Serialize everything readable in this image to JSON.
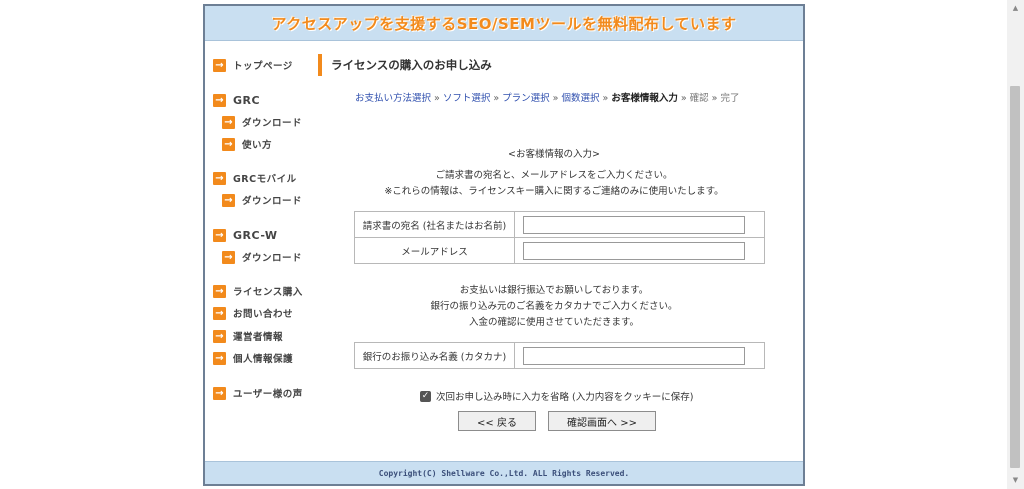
{
  "banner": {
    "text": "アクセスアップを支援するSEO/SEMツールを無料配布しています"
  },
  "sidebar": {
    "items": [
      {
        "label": "トップページ"
      },
      {
        "label": "GRC"
      },
      {
        "label": "ダウンロード"
      },
      {
        "label": "使い方"
      },
      {
        "label": "GRCモバイル"
      },
      {
        "label": "ダウンロード"
      },
      {
        "label": "GRC-W"
      },
      {
        "label": "ダウンロード"
      },
      {
        "label": "ライセンス購入"
      },
      {
        "label": "お問い合わせ"
      },
      {
        "label": "運営者情報"
      },
      {
        "label": "個人情報保護"
      },
      {
        "label": "ユーザー様の声"
      }
    ]
  },
  "main": {
    "heading": "ライセンスの購入のお申し込み",
    "breadcrumb": {
      "steps": [
        "お支払い方法選択",
        "ソフト選択",
        "プラン選択",
        "個数選択",
        "お客様情報入力",
        "確認",
        "完了"
      ],
      "separator": "»"
    },
    "customer_section": {
      "title": "<お客様情報の入力>",
      "line1": "ご請求書の宛名と、メールアドレスをご入力ください。",
      "line2": "※これらの情報は、ライセンスキー購入に関するご連絡のみに使用いたします。"
    },
    "fields": {
      "invoice_name": {
        "label": "請求書の宛名 (社名またはお名前)",
        "value": ""
      },
      "email": {
        "label": "メールアドレス",
        "value": ""
      },
      "bank_name": {
        "label": "銀行のお振り込み名義 (カタカナ)",
        "value": ""
      }
    },
    "payment_section": {
      "line1": "お支払いは銀行振込でお願いしております。",
      "line2": "銀行の振り込み元のご名義をカタカナでご入力ください。",
      "line3": "入金の確認に使用させていただきます。"
    },
    "remember": {
      "label": "次回お申し込み時に入力を省略 (入力内容をクッキーに保存)",
      "checked": true
    },
    "buttons": {
      "back": "<< 戻る",
      "next": "確認画面へ >>"
    }
  },
  "footer": {
    "text": "Copyright(C) Shellware Co.,Ltd. ALL Rights Reserved."
  },
  "colors": {
    "accent": "#f28a1c",
    "banner_bg": "#c9dff1",
    "link": "#2f4fae"
  }
}
